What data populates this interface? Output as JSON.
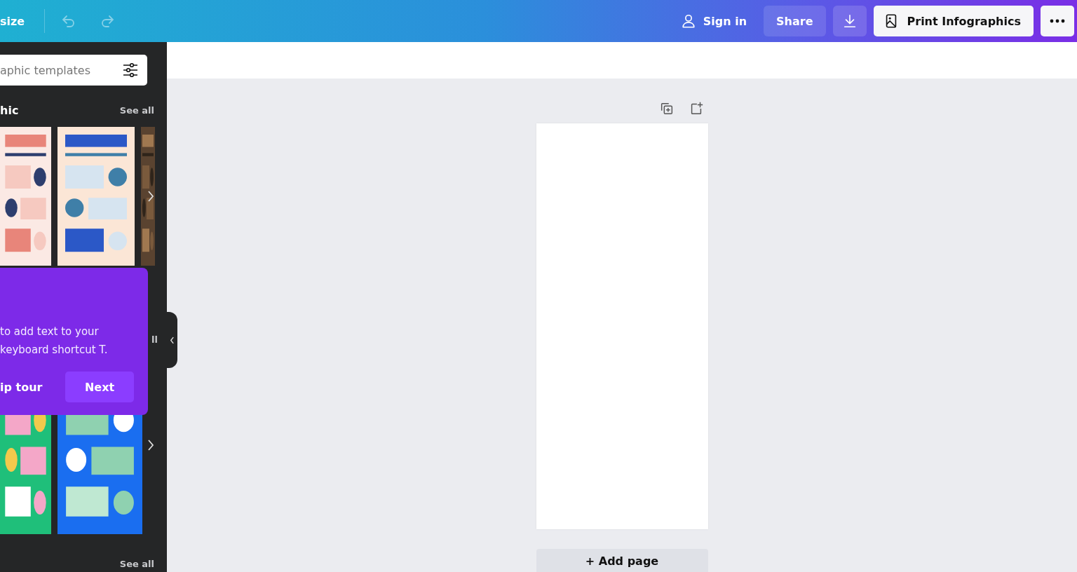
{
  "top_bar": {
    "resize_label": "size",
    "sign_in": "Sign in",
    "share": "Share",
    "print_button": "Print Infographics"
  },
  "sidebar": {
    "search": {
      "placeholder": "aphic templates"
    },
    "sections": [
      {
        "title": "hic",
        "see_all": "See all"
      },
      {
        "see_all": "ll"
      },
      {
        "see_all": "See all"
      }
    ]
  },
  "tour_tooltip": {
    "lines": [
      "to add text to your",
      "keyboard shortcut T."
    ],
    "skip": "ip tour",
    "next": "Next"
  },
  "canvas": {
    "add_page": "+ Add page"
  }
}
